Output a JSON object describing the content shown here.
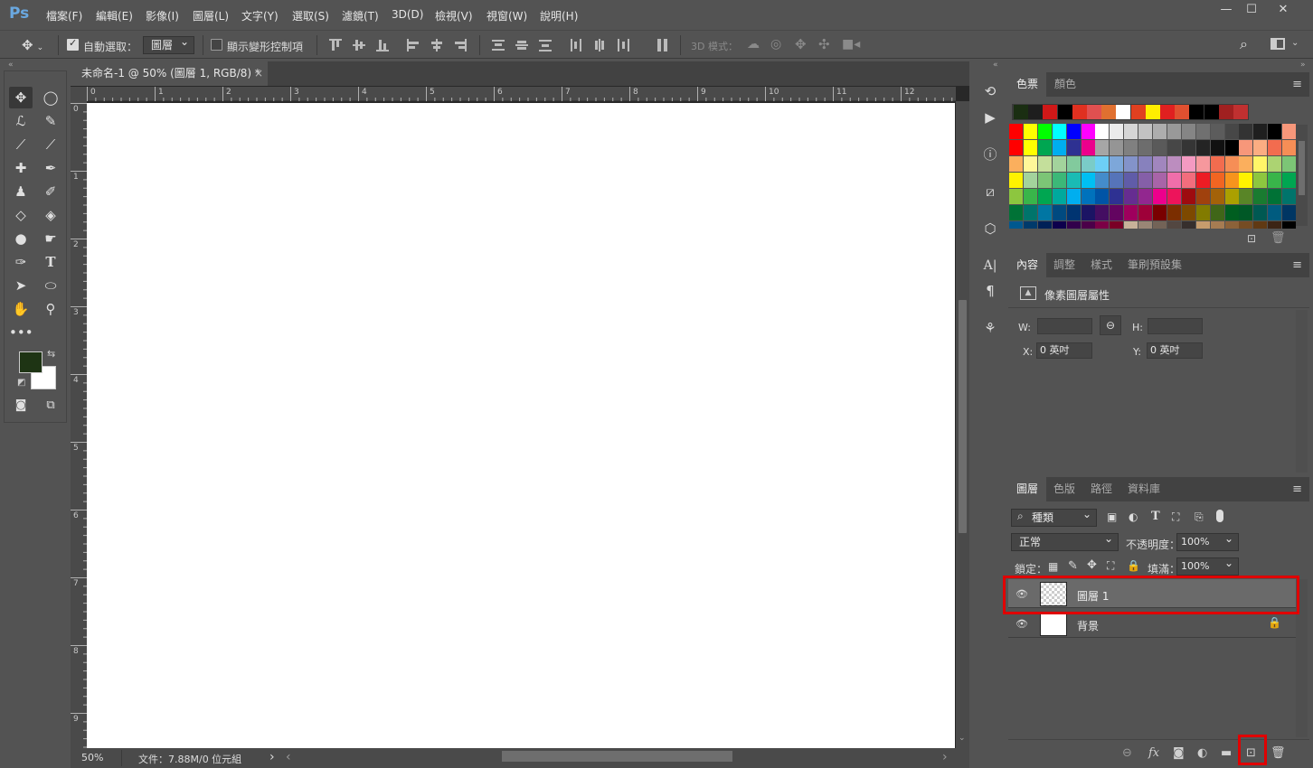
{
  "app": {
    "logo": "Ps"
  },
  "menu": [
    "檔案(F)",
    "編輯(E)",
    "影像(I)",
    "圖層(L)",
    "文字(Y)",
    "選取(S)",
    "濾鏡(T)",
    "3D(D)",
    "檢視(V)",
    "視窗(W)",
    "說明(H)"
  ],
  "window_controls": {
    "minimize": "—",
    "maximize": "☐",
    "close": "✕"
  },
  "options": {
    "auto_select_label": "自動選取：",
    "auto_select_checked": true,
    "auto_select_value": "圖層",
    "show_transform_label": "顯示變形控制項",
    "show_transform_checked": false,
    "mode_3d_label": "3D 模式："
  },
  "document": {
    "tab_title": "未命名-1 @ 50% (圖層 1, RGB/8) *",
    "tab_close": "×",
    "ruler_h": [
      "0",
      "1",
      "2",
      "3",
      "4",
      "5",
      "6",
      "7",
      "8",
      "9",
      "10",
      "11",
      "12"
    ],
    "ruler_v": [
      "0",
      "1",
      "2",
      "3",
      "4",
      "5",
      "6",
      "7",
      "8",
      "9"
    ],
    "canvas_color": "#ffffff"
  },
  "status": {
    "zoom": "50%",
    "doc_info": "文件：7.88M/0 位元組",
    "arrow": "›",
    "scroll_left": "‹",
    "scroll_right": "›"
  },
  "colors": {
    "foreground": "#1e3414",
    "background": "#ffffff",
    "highlight": "#e00000"
  },
  "swatches_panel": {
    "tabs": [
      "色票",
      "顏色"
    ],
    "active_tab": "色票",
    "recent": [
      "#1a2e12",
      "#1e1e1e",
      "#d01818",
      "#000000",
      "#e03020",
      "#e05050",
      "#e07030",
      "#ffffff",
      "#e04020",
      "#ffee00",
      "#e02020",
      "#e05030",
      "#000000",
      "#000000",
      "#a02020",
      "#c03030"
    ],
    "rows": [
      [
        "#ff0000",
        "#ffff00",
        "#00ff00",
        "#00ffff",
        "#0000ff",
        "#ff00ff",
        "#ffffff",
        "#ebebeb",
        "#d6d6d6",
        "#c2c2c2",
        "#adadad",
        "#999999",
        "#858585",
        "#707070",
        "#5c5c5c",
        "#474747",
        "#333333",
        "#1f1f1f",
        "#000000",
        "#f7977a"
      ],
      [
        "#ff0000",
        "#ffff00",
        "#00a651",
        "#00aeef",
        "#2e3192",
        "#ec008c",
        "#a6a6a6",
        "#959595",
        "#808080",
        "#6d6d6d",
        "#5a5a5a",
        "#474747",
        "#353535",
        "#242424",
        "#111111",
        "#000000",
        "#f7977a",
        "#fbad82",
        "#f26c4f",
        "#f68e56"
      ],
      [
        "#fbaf5d",
        "#fff799",
        "#c4df9b",
        "#a3d39c",
        "#82ca9d",
        "#7accc8",
        "#6dcff6",
        "#7da7d9",
        "#8393ca",
        "#8781bd",
        "#a186be",
        "#bc8dbf",
        "#f49ac2",
        "#f6989d",
        "#f26c4f",
        "#f68e56",
        "#fbaf5d",
        "#fff568",
        "#acd372",
        "#7cc576"
      ],
      [
        "#fff200",
        "#a3d39c",
        "#7cc576",
        "#3cb878",
        "#1abbb4",
        "#00bff3",
        "#448ccb",
        "#5674b9",
        "#605ca8",
        "#855fa8",
        "#a864a8",
        "#f06eaa",
        "#f26d7d",
        "#ed1c24",
        "#f26522",
        "#f7941d",
        "#fff200",
        "#8dc63f",
        "#39b54a",
        "#00a651"
      ],
      [
        "#8dc63f",
        "#39b54a",
        "#00a651",
        "#00a99d",
        "#00aeef",
        "#0072bc",
        "#0054a6",
        "#2e3192",
        "#662d91",
        "#92278f",
        "#ec008c",
        "#ed145b",
        "#9e0b0f",
        "#a0410d",
        "#a36209",
        "#aba000",
        "#598527",
        "#197b30",
        "#007236",
        "#00746b"
      ],
      [
        "#007236",
        "#00746b",
        "#0076a3",
        "#004a80",
        "#003471",
        "#1b1464",
        "#440e62",
        "#630460",
        "#9e005d",
        "#9e0039",
        "#790000",
        "#7b2e00",
        "#7d4900",
        "#827b00",
        "#406618",
        "#005e20",
        "#005826",
        "#005952",
        "#005b7f",
        "#003663"
      ],
      [
        "#00588f",
        "#003a6b",
        "#002157",
        "#0d004c",
        "#32004b",
        "#4b0049",
        "#7b0046",
        "#7a0026",
        "#c7b299",
        "#998675",
        "#736357",
        "#534741",
        "#362f2d",
        "#c69c6d",
        "#a67c52",
        "#8c6239",
        "#754c24",
        "#603913",
        "#3c2415",
        "#000000"
      ]
    ]
  },
  "properties_panel": {
    "tabs": [
      "內容",
      "調整",
      "樣式",
      "筆刷預設集"
    ],
    "active_tab": "內容",
    "title": "像素圖層屬性",
    "w_label": "W:",
    "h_label": "H:",
    "w_value": "",
    "h_value": "",
    "x_label": "X:",
    "y_label": "Y:",
    "x_value": "0 英吋",
    "y_value": "0 英吋"
  },
  "layers_panel": {
    "tabs": [
      "圖層",
      "色版",
      "路徑",
      "資料庫"
    ],
    "active_tab": "圖層",
    "filter_kind": "種類",
    "blend_mode": "正常",
    "opacity_label": "不透明度：",
    "opacity_value": "100%",
    "lock_label": "鎖定：",
    "fill_label": "填滿：",
    "fill_value": "100%",
    "layers": [
      {
        "name": "圖層 1",
        "selected": true,
        "visible": true,
        "locked": false
      },
      {
        "name": "背景",
        "selected": false,
        "visible": true,
        "locked": true
      }
    ]
  }
}
